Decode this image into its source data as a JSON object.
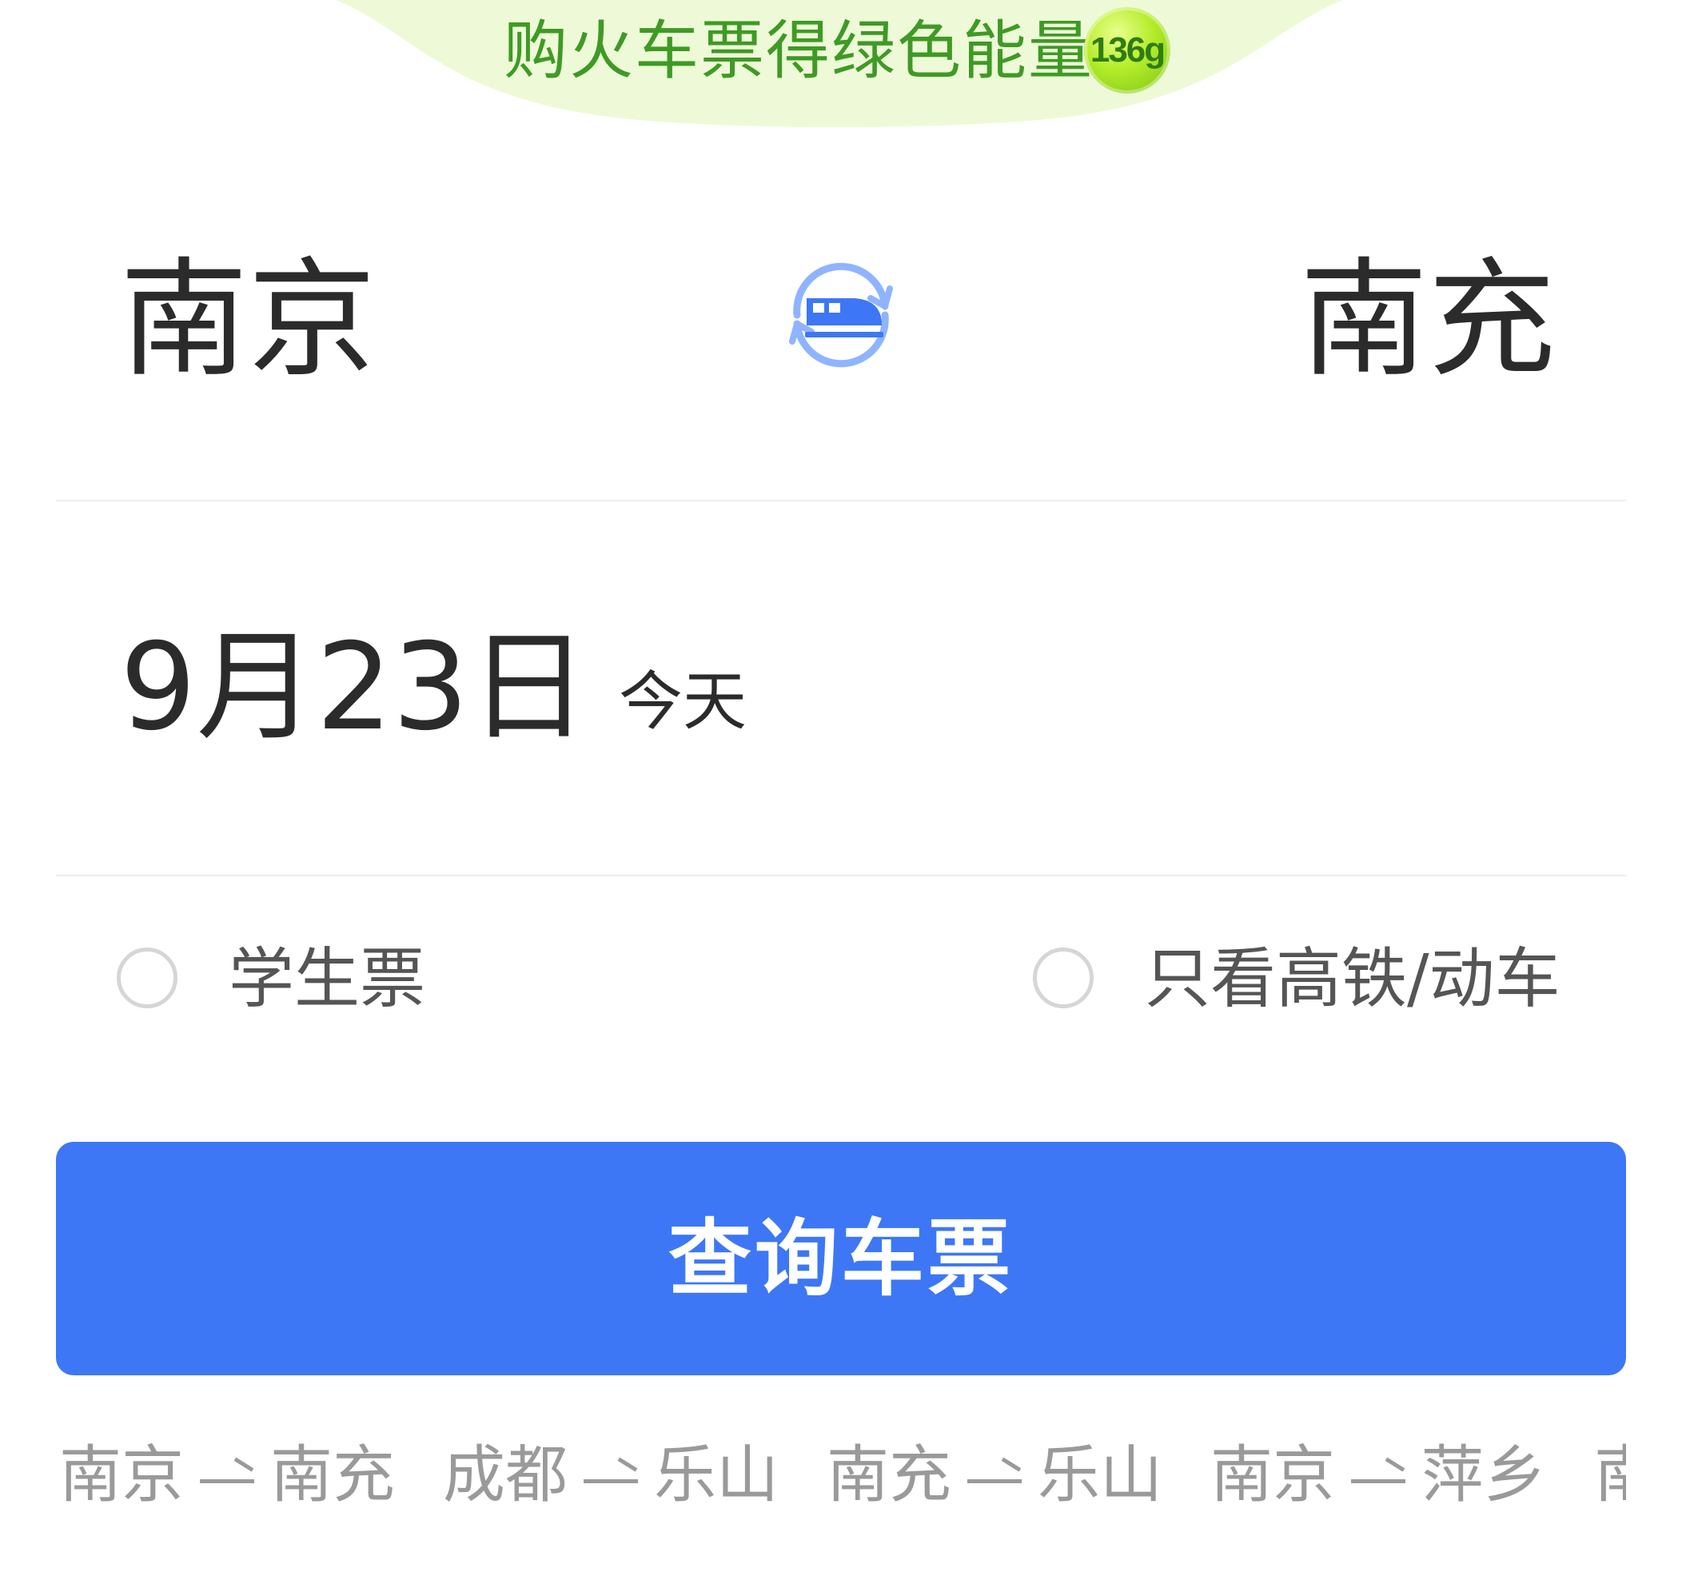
{
  "banner": {
    "text": "购火车票得绿色能量",
    "energy_badge": "136g"
  },
  "route": {
    "from_city": "南京",
    "to_city": "南充",
    "swap_icon": "train-swap-icon"
  },
  "date": {
    "value": "9月23日",
    "relative": "今天"
  },
  "options": {
    "student_ticket": {
      "label": "学生票",
      "checked": false
    },
    "highspeed_only": {
      "label": "只看高铁/动车",
      "checked": false
    }
  },
  "search_button": {
    "label": "查询车票"
  },
  "history": [
    {
      "from": "南京",
      "to": "南充"
    },
    {
      "from": "成都",
      "to": "乐山"
    },
    {
      "from": "南充",
      "to": "乐山"
    },
    {
      "from": "南京",
      "to": "萍乡"
    },
    {
      "from": "南",
      "to": ""
    }
  ],
  "colors": {
    "primary": "#3d77f5",
    "banner_green": "#3f9a25",
    "banner_bg": "#eefad7",
    "icon_light_blue": "#8fb4ff",
    "text_dark": "#2b2b2b",
    "text_gray": "#9a9a9a"
  }
}
